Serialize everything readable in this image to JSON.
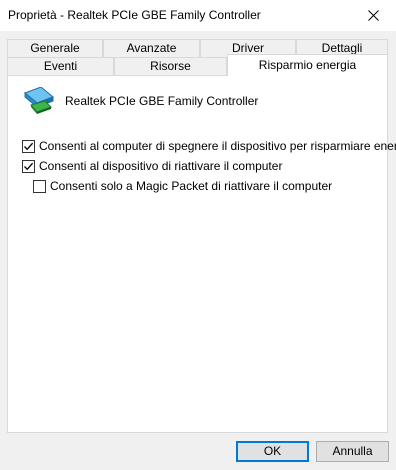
{
  "window": {
    "title": "Proprietà - Realtek PCIe GBE Family Controller"
  },
  "tabs": {
    "row1": [
      "Generale",
      "Avanzate",
      "Driver",
      "Dettagli"
    ],
    "row2": [
      "Eventi",
      "Risorse",
      "Risparmio energia"
    ],
    "active": "Risparmio energia"
  },
  "panel": {
    "device_name": "Realtek PCIe GBE Family Controller",
    "options": [
      {
        "label": "Consenti al computer di spegnere il dispositivo per risparmiare energia",
        "checked": true
      },
      {
        "label": "Consenti al dispositivo di riattivare il computer",
        "checked": true
      },
      {
        "label": "Consenti solo a Magic Packet di riattivare il computer",
        "checked": false
      }
    ]
  },
  "buttons": {
    "ok": "OK",
    "cancel": "Annulla"
  },
  "colors": {
    "accent": "#0078d7",
    "border": "#d9d9d9",
    "button_face": "#e1e1e1"
  },
  "icons": {
    "close": "close-icon",
    "device": "network-adapter-icon",
    "check": "checkmark-icon"
  }
}
